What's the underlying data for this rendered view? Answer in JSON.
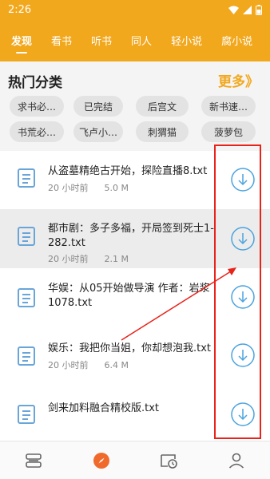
{
  "status": {
    "time": "2:26"
  },
  "tabs": [
    {
      "label": "发现",
      "active": true
    },
    {
      "label": "看书",
      "active": false
    },
    {
      "label": "听书",
      "active": false
    },
    {
      "label": "同人",
      "active": false
    },
    {
      "label": "轻小说",
      "active": false
    },
    {
      "label": "腐小说",
      "active": false
    }
  ],
  "section": {
    "title": "热门分类",
    "more": "更多》"
  },
  "chips": [
    "求书必…",
    "已完结",
    "后宫文",
    "新书速…",
    "书荒必…",
    "飞卢小…",
    "刺猬猫",
    "菠萝包"
  ],
  "files": [
    {
      "title": "从盗墓精绝古开始，探险直播8.txt",
      "time": "20 小时前",
      "size": "5.0 M"
    },
    {
      "title": "都市剧：多子多福，开局签到死士1-282.txt",
      "time": "20 小时前",
      "size": "2.1 M"
    },
    {
      "title": "华娱：从05开始做导演 作者：岩浆1078.txt",
      "time": "",
      "size": ""
    },
    {
      "title": "娱乐：我把你当姐，你却想泡我.txt",
      "time": "20 小时前",
      "size": "6.4 M"
    },
    {
      "title": "剑来加料融合精校版.txt",
      "time": "",
      "size": ""
    }
  ],
  "colors": {
    "accent": "#f2a81d",
    "download": "#4aa3df",
    "annotation": "#e8231a"
  },
  "nav": [
    "bookshelf-icon",
    "discover-icon",
    "history-icon",
    "profile-icon"
  ]
}
